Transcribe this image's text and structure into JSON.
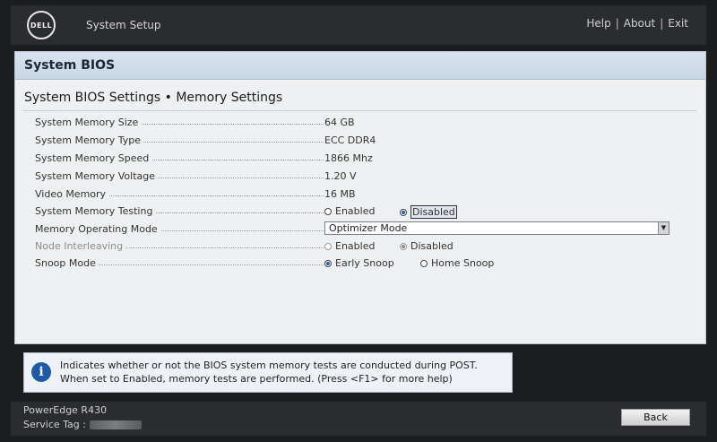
{
  "header": {
    "logo_text": "DELL",
    "app_title": "System Setup",
    "links": [
      "Help",
      "About",
      "Exit"
    ]
  },
  "panel": {
    "title": "System BIOS",
    "section_title": "System BIOS Settings • Memory Settings"
  },
  "settings": {
    "size": {
      "label": "System Memory Size",
      "value": "64 GB"
    },
    "type": {
      "label": "System Memory Type",
      "value": "ECC DDR4"
    },
    "speed": {
      "label": "System Memory Speed",
      "value": "1866 Mhz"
    },
    "voltage": {
      "label": "System Memory Voltage",
      "value": "1.20 V"
    },
    "video": {
      "label": "Video Memory",
      "value": "16 MB"
    },
    "testing": {
      "label": "System Memory Testing",
      "options": [
        "Enabled",
        "Disabled"
      ],
      "selected": "Disabled"
    },
    "mode": {
      "label": "Memory Operating Mode",
      "value": "Optimizer Mode"
    },
    "interleave": {
      "label": "Node Interleaving",
      "options": [
        "Enabled",
        "Disabled"
      ],
      "selected": "Disabled"
    },
    "snoop": {
      "label": "Snoop Mode",
      "options": [
        "Early Snoop",
        "Home Snoop"
      ],
      "selected": "Early Snoop"
    }
  },
  "help": {
    "line1": "Indicates whether or not the BIOS system memory tests are conducted during POST.",
    "line2": "When set to Enabled, memory tests are performed. (Press <F1> for more help)"
  },
  "footer": {
    "model": "PowerEdge R430",
    "service_tag_label": "Service Tag :",
    "back_label": "Back"
  }
}
